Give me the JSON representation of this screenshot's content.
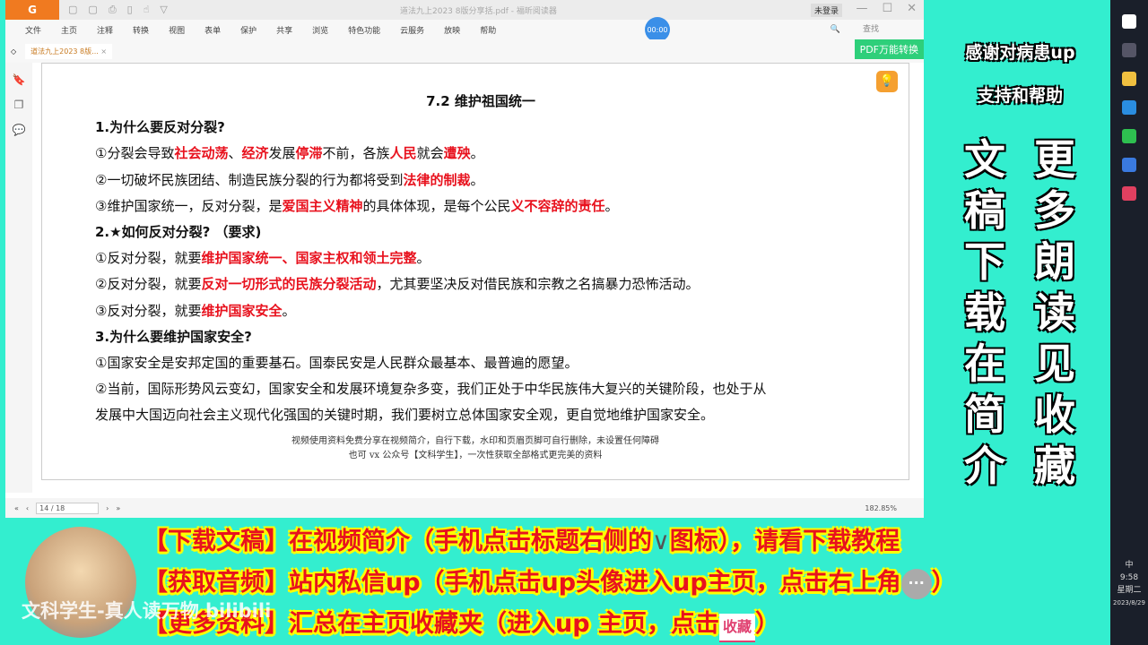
{
  "app": {
    "logo": "G",
    "title": "道法九上2023 8版分享括.pdf - 福昕阅读器",
    "login": "未登录",
    "timer": "00:00",
    "search_placeholder": "查找",
    "pdf_convert": "PDF万能转换",
    "menu": [
      "文件",
      "主页",
      "注释",
      "转换",
      "视图",
      "表单",
      "保护",
      "共享",
      "浏览",
      "特色功能",
      "云服务",
      "放映",
      "帮助"
    ],
    "tab": "道法九上2023 8版...",
    "page_indicator": "14 / 18",
    "zoom": "182.85%"
  },
  "document": {
    "title": "7.2  维护祖国统一",
    "lines": [
      {
        "h": true,
        "segs": [
          {
            "t": "1.为什么要反对分裂?"
          }
        ]
      },
      {
        "segs": [
          {
            "t": "①分裂会导致"
          },
          {
            "t": "社会动荡",
            "r": true
          },
          {
            "t": "、"
          },
          {
            "t": "经济",
            "r": true
          },
          {
            "t": "发展"
          },
          {
            "t": "停滞",
            "r": true
          },
          {
            "t": "不前，各族"
          },
          {
            "t": "人民",
            "r": true
          },
          {
            "t": "就会"
          },
          {
            "t": "遭殃",
            "r": true
          },
          {
            "t": "。"
          }
        ]
      },
      {
        "segs": [
          {
            "t": "②一切破坏民族团结、制造民族分裂的行为都将受到"
          },
          {
            "t": "法律的制裁",
            "r": true
          },
          {
            "t": "。"
          }
        ]
      },
      {
        "segs": [
          {
            "t": "③维护国家统一，反对分裂，是"
          },
          {
            "t": "爱国主义精神",
            "r": true
          },
          {
            "t": "的具体体现，是每个公民"
          },
          {
            "t": "义不容辞的责任",
            "r": true
          },
          {
            "t": "。"
          }
        ]
      },
      {
        "h": true,
        "segs": [
          {
            "t": "2.★如何反对分裂? （要求)"
          }
        ]
      },
      {
        "segs": [
          {
            "t": "①反对分裂，就要"
          },
          {
            "t": "维护国家统一、国家主权和领土完整",
            "r": true
          },
          {
            "t": "。"
          }
        ]
      },
      {
        "segs": [
          {
            "t": "②反对分裂，就要"
          },
          {
            "t": "反对一切形式的民族分裂活动",
            "r": true
          },
          {
            "t": "，尤其要坚决反对借民族和宗教之名搞暴力恐怖活动。"
          }
        ]
      },
      {
        "segs": [
          {
            "t": "③反对分裂，就要"
          },
          {
            "t": "维护国家安全",
            "r": true
          },
          {
            "t": "。"
          }
        ]
      },
      {
        "h": true,
        "segs": [
          {
            "t": "3.为什么要维护国家安全?"
          }
        ]
      },
      {
        "segs": [
          {
            "t": "①国家安全是安邦定国的重要基石。国泰民安是人民群众最基本、最普遍的愿望。"
          }
        ]
      },
      {
        "segs": [
          {
            "t": "②当前，国际形势风云变幻，国家安全和发展环境复杂多变，我们正处于中华民族伟大复兴的关键阶段，也处于从"
          }
        ]
      },
      {
        "segs": [
          {
            "t": "发展中大国迈向社会主义现代化强国的关键时期，我们要树立总体国家安全观，更自觉地维护国家安全。"
          }
        ]
      }
    ],
    "footer1": "视频使用资料免费分享在视频简介，自行下载，水印和页眉页脚可自行删除，未设置任何障碍",
    "footer2": "也可 vx 公众号【文科学生】，一次性获取全部格式更完美的资料"
  },
  "right_panel": {
    "thanks1": "感谢对病患up",
    "thanks2": "支持和帮助",
    "col_left": "文稿下载在简介",
    "col_right": "更多朗读见收藏"
  },
  "banner": {
    "line1a": "【下载文稿】在视频简介（手机点击标题右侧的",
    "v_icon": "∨",
    "line1b": "图标），请看下载教程",
    "line2": "【获取音频】站内私信up（手机点击up头像进入up主页，点击右上角",
    "chat_icon": "···",
    "line2_end": "）",
    "line3": "【更多资料】汇总在主页收藏夹（进入up 主页，点击",
    "fav": "收藏",
    "line3_end": "）",
    "watermark": "文科学生-真人读万物 bilibili"
  },
  "taskbar": {
    "time": "9:58",
    "weekday": "星期二",
    "date": "2023/8/29",
    "ime": "中"
  }
}
